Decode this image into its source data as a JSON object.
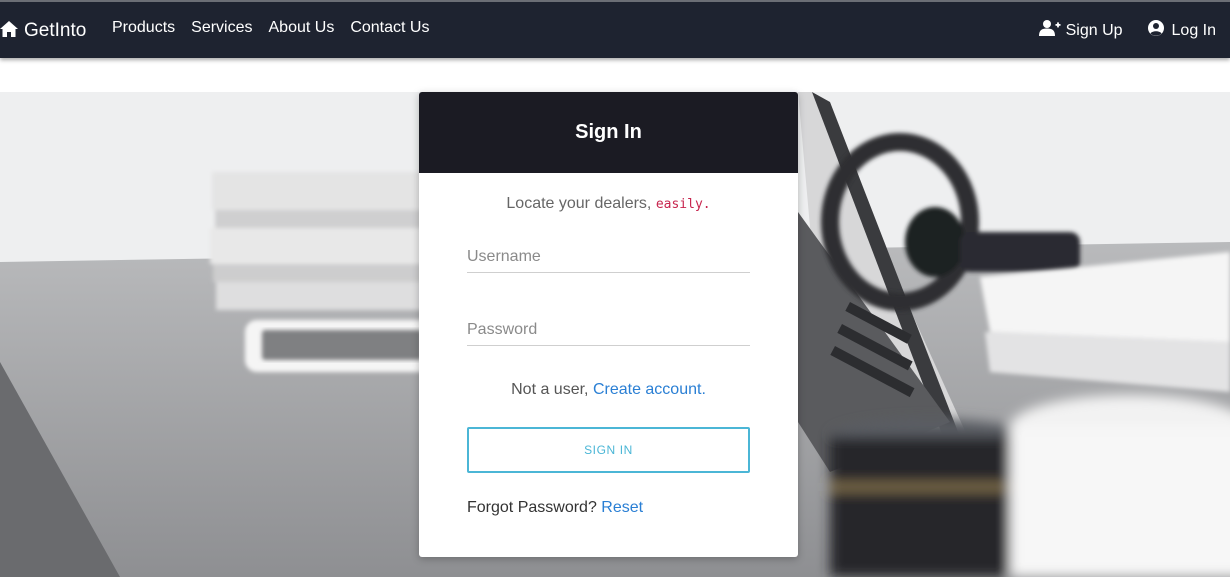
{
  "navbar": {
    "brand": "GetInto",
    "links": [
      "Products",
      "Services",
      "About Us",
      "Contact Us"
    ],
    "signup_label": "Sign Up",
    "login_label": "Log In"
  },
  "card": {
    "title": "Sign In",
    "tagline_text": "Locate your dealers, ",
    "tagline_code": "easily.",
    "username_placeholder": "Username",
    "password_placeholder": "Password",
    "signup_prefix": "Not a user, ",
    "signup_link": "Create account.",
    "signin_button": "SIGN IN",
    "forgot_prefix": "Forgot Password? ",
    "forgot_link": "Reset"
  },
  "icons": {
    "brand": "home-icon",
    "signup": "user-plus-icon",
    "login": "user-circle-icon"
  },
  "colors": {
    "navbar_bg": "#1e2330",
    "card_header_bg": "#1b1b23",
    "link": "#2a7fd4",
    "button_accent": "#4bb6d6",
    "tagline_code": "#c7254e"
  }
}
